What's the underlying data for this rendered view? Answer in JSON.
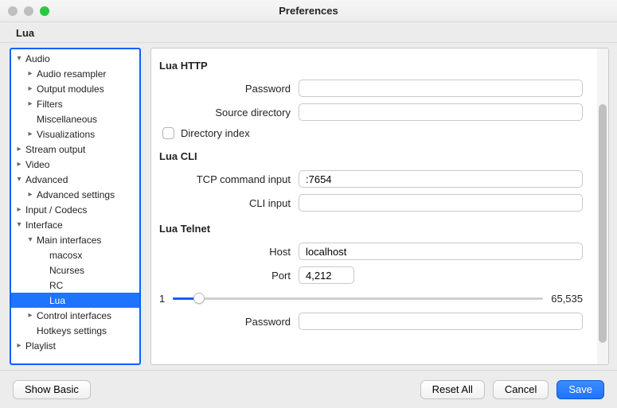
{
  "window": {
    "title": "Preferences"
  },
  "section": {
    "title": "Lua"
  },
  "tree": {
    "items": [
      {
        "id": "audio",
        "label": "Audio",
        "indent": 0,
        "disclosure": "down",
        "selected": false
      },
      {
        "id": "audio-resampler",
        "label": "Audio resampler",
        "indent": 1,
        "disclosure": "right",
        "selected": false
      },
      {
        "id": "output-modules",
        "label": "Output modules",
        "indent": 1,
        "disclosure": "right",
        "selected": false
      },
      {
        "id": "filters",
        "label": "Filters",
        "indent": 1,
        "disclosure": "right",
        "selected": false
      },
      {
        "id": "miscellaneous",
        "label": "Miscellaneous",
        "indent": 1,
        "disclosure": "none",
        "selected": false
      },
      {
        "id": "visualizations",
        "label": "Visualizations",
        "indent": 1,
        "disclosure": "right",
        "selected": false
      },
      {
        "id": "stream-output",
        "label": "Stream output",
        "indent": 0,
        "disclosure": "right",
        "selected": false
      },
      {
        "id": "video",
        "label": "Video",
        "indent": 0,
        "disclosure": "right",
        "selected": false
      },
      {
        "id": "advanced",
        "label": "Advanced",
        "indent": 0,
        "disclosure": "down",
        "selected": false
      },
      {
        "id": "advanced-settings",
        "label": "Advanced settings",
        "indent": 1,
        "disclosure": "right",
        "selected": false
      },
      {
        "id": "input-codecs",
        "label": "Input / Codecs",
        "indent": 0,
        "disclosure": "right",
        "selected": false
      },
      {
        "id": "interface",
        "label": "Interface",
        "indent": 0,
        "disclosure": "down",
        "selected": false
      },
      {
        "id": "main-interfaces",
        "label": "Main interfaces",
        "indent": 1,
        "disclosure": "down",
        "selected": false
      },
      {
        "id": "macosx",
        "label": "macosx",
        "indent": 2,
        "disclosure": "none",
        "selected": false
      },
      {
        "id": "ncurses",
        "label": "Ncurses",
        "indent": 2,
        "disclosure": "none",
        "selected": false
      },
      {
        "id": "rc",
        "label": "RC",
        "indent": 2,
        "disclosure": "none",
        "selected": false
      },
      {
        "id": "lua",
        "label": "Lua",
        "indent": 2,
        "disclosure": "none",
        "selected": true
      },
      {
        "id": "control-interfaces",
        "label": "Control interfaces",
        "indent": 1,
        "disclosure": "right",
        "selected": false
      },
      {
        "id": "hotkeys-settings",
        "label": "Hotkeys settings",
        "indent": 1,
        "disclosure": "none",
        "selected": false
      },
      {
        "id": "playlist",
        "label": "Playlist",
        "indent": 0,
        "disclosure": "right",
        "selected": false
      }
    ]
  },
  "content": {
    "http": {
      "title": "Lua HTTP",
      "password_label": "Password",
      "password_value": "",
      "srcdir_label": "Source directory",
      "srcdir_value": "",
      "dirindex_label": "Directory index",
      "dirindex_checked": false
    },
    "cli": {
      "title": "Lua CLI",
      "tcp_label": "TCP command input",
      "tcp_value": ":7654",
      "cli_label": "CLI input",
      "cli_value": ""
    },
    "telnet": {
      "title": "Lua Telnet",
      "host_label": "Host",
      "host_value": "localhost",
      "port_label": "Port",
      "port_value": "4,212",
      "port_min": "1",
      "port_max": "65,535",
      "password_label": "Password",
      "password_value": ""
    }
  },
  "footer": {
    "show_basic": "Show Basic",
    "reset_all": "Reset All",
    "cancel": "Cancel",
    "save": "Save"
  }
}
